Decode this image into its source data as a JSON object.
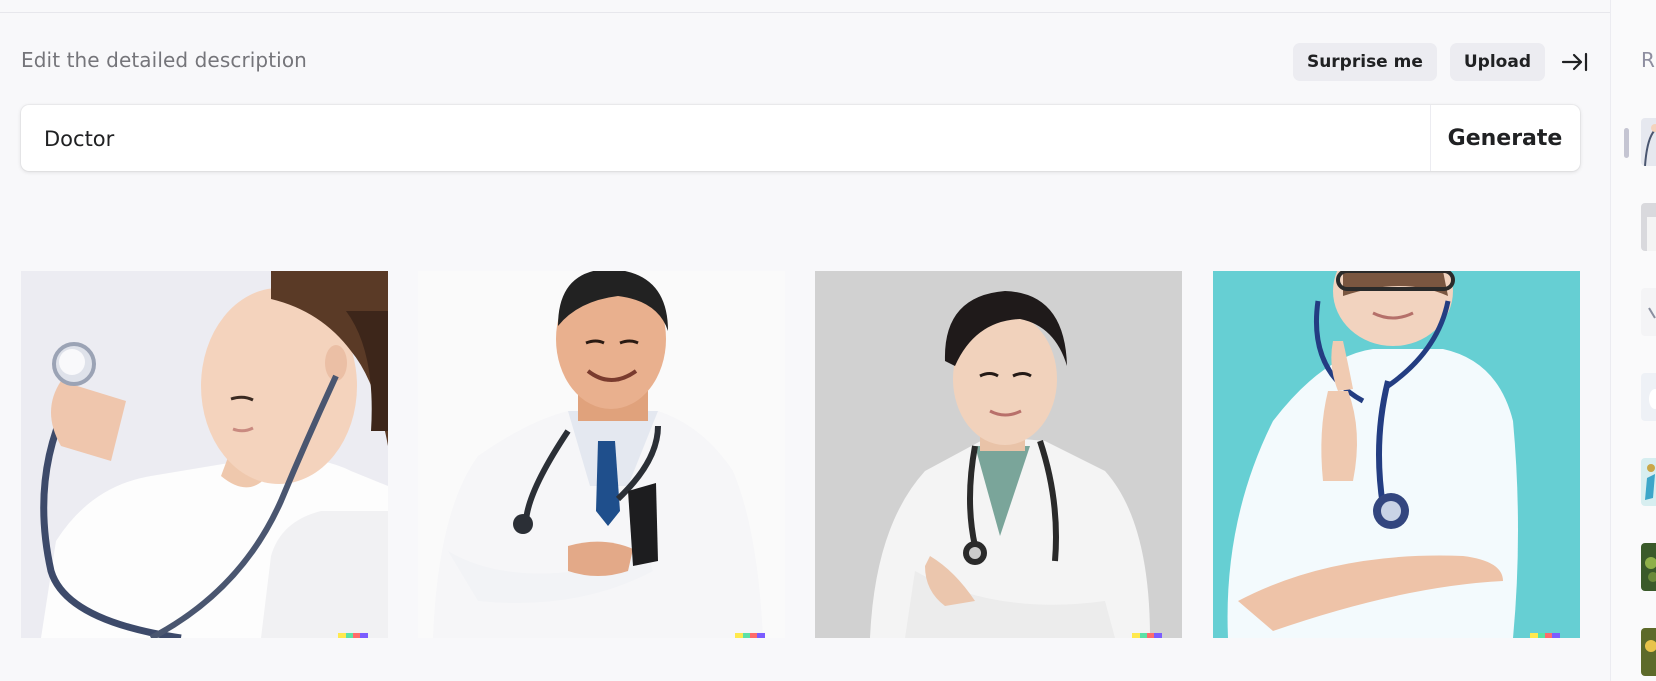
{
  "editor": {
    "heading": "Edit the detailed description",
    "surprise_label": "Surprise me",
    "upload_label": "Upload",
    "prompt_value": "Doctor",
    "generate_label": "Generate"
  },
  "results": {
    "images": [
      {
        "subject": "female doctor holding stethoscope",
        "background": "#eeeef3"
      },
      {
        "subject": "male doctor in white coat",
        "background": "#fafafa"
      },
      {
        "subject": "female doctor leaning forward",
        "background": "#d3d3d3"
      },
      {
        "subject": "female doctor on turquoise background",
        "background": "#67cfd3"
      }
    ]
  },
  "sidebar": {
    "label": "R"
  },
  "colors": {
    "page_bg": "#f8f8fa",
    "pill_bg": "#ececf1",
    "text": "#202123",
    "muted": "#75757a"
  },
  "icons": {
    "collapse": "arrow-right-to-bar-icon"
  }
}
